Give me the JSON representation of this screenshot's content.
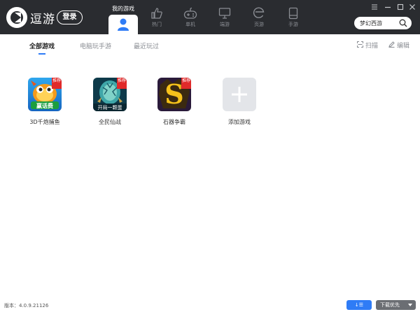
{
  "header": {
    "brand": "逗游",
    "login_label": "登录",
    "nav": [
      {
        "label": "我的游戏",
        "icon": "user-icon",
        "active": true
      },
      {
        "label": "热门",
        "icon": "thumbs-up-icon"
      },
      {
        "label": "单机",
        "icon": "gamepad-icon"
      },
      {
        "label": "端游",
        "icon": "monitor-icon"
      },
      {
        "label": "页游",
        "icon": "browser-e-icon"
      },
      {
        "label": "手游",
        "icon": "mobile-icon"
      }
    ],
    "search_value": "梦幻西游",
    "search_icon": "search-icon",
    "window_controls": [
      "menu-icon",
      "minimize-icon",
      "maximize-icon",
      "close-icon"
    ]
  },
  "tabs": {
    "items": [
      {
        "label": "全部游戏",
        "active": true
      },
      {
        "label": "电脑玩手游"
      },
      {
        "label": "最近玩过"
      }
    ],
    "scan_label": "扫描",
    "edit_label": "编辑"
  },
  "games": [
    {
      "name": "3D千炮捕鱼",
      "badge": "推荐",
      "art_text": "赢话费"
    },
    {
      "name": "全民仙战",
      "badge": "推荐",
      "art_text": "开局一颗蛋"
    },
    {
      "name": "石器争霸",
      "badge": "推荐",
      "art_text": "S"
    }
  ],
  "add_game_label": "添加游戏",
  "footer": {
    "version": "版本：4.0.9.21126",
    "download_btn": "↓☰",
    "priority_btn": "下载优先"
  },
  "colors": {
    "topbar": "#2a2c30",
    "accent": "#2f7cf6",
    "badge": "#e02a2a"
  }
}
